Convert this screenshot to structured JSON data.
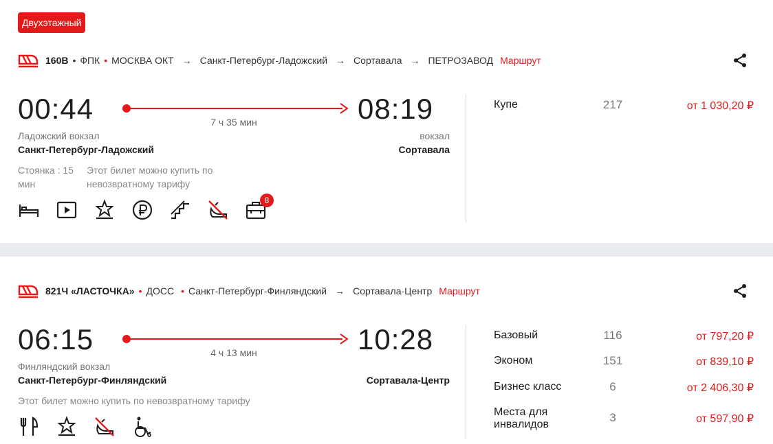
{
  "trains": [
    {
      "badge": "Двухэтажный",
      "number": "160В",
      "carrier": "ФПК",
      "route_stops": [
        "МОСКВА ОКТ",
        "Санкт-Петербург-Ладожский",
        "Сортавала",
        "ПЕТРОЗАВОД"
      ],
      "route_link": "Маршрут",
      "departure_time": "00:44",
      "arrival_time": "08:19",
      "duration": "7 ч 35 мин",
      "departure_station_label": "Ладожский вокзал",
      "departure_station": "Санкт-Петербург-Ладожский",
      "arrival_station_label": "вокзал",
      "arrival_station": "Сортавала",
      "stop_note": "Стоянка : 15 мин",
      "stop_note_line1": "Стоянка : 15",
      "stop_note_line2": "мин",
      "tariff_note_line1": "Этот билет можно купить по",
      "tariff_note_line2": "невозвратному тарифу",
      "amenities": [
        "bed-icon",
        "video-icon",
        "star-podium-icon",
        "ruble-icon",
        "stairs-icon",
        "no-pets-icon",
        "luggage-icon"
      ],
      "luggage_count": "8",
      "classes": [
        {
          "name": "Купе",
          "seats": "217",
          "price": "от 1 030,20 ₽"
        }
      ]
    },
    {
      "number": "821Ч «ЛАСТОЧКА»",
      "carrier": "ДОСС",
      "route_stops": [
        "Санкт-Петербург-Финляндский",
        "Сортавала-Центр"
      ],
      "route_link": "Маршрут",
      "departure_time": "06:15",
      "arrival_time": "10:28",
      "duration": "4 ч 13 мин",
      "departure_station_label": "Финляндский вокзал",
      "departure_station": "Санкт-Петербург-Финляндский",
      "arrival_station": "Сортавала-Центр",
      "tariff_note": "Этот билет можно купить по невозвратному тарифу",
      "amenities": [
        "food-icon",
        "star-podium-icon",
        "no-pets-icon",
        "wheelchair-icon"
      ],
      "classes": [
        {
          "name": "Базовый",
          "seats": "116",
          "price": "от 797,20 ₽"
        },
        {
          "name": "Эконом",
          "seats": "151",
          "price": "от 839,10 ₽"
        },
        {
          "name": "Бизнес класс",
          "seats": "6",
          "price": "от 2 406,30 ₽"
        },
        {
          "name_line1": "Места для",
          "name_line2": "инвалидов",
          "seats": "3",
          "price": "от 597,90 ₽"
        }
      ]
    }
  ],
  "colors": {
    "accent": "#e21a1a",
    "separator": "#e9ebee"
  }
}
